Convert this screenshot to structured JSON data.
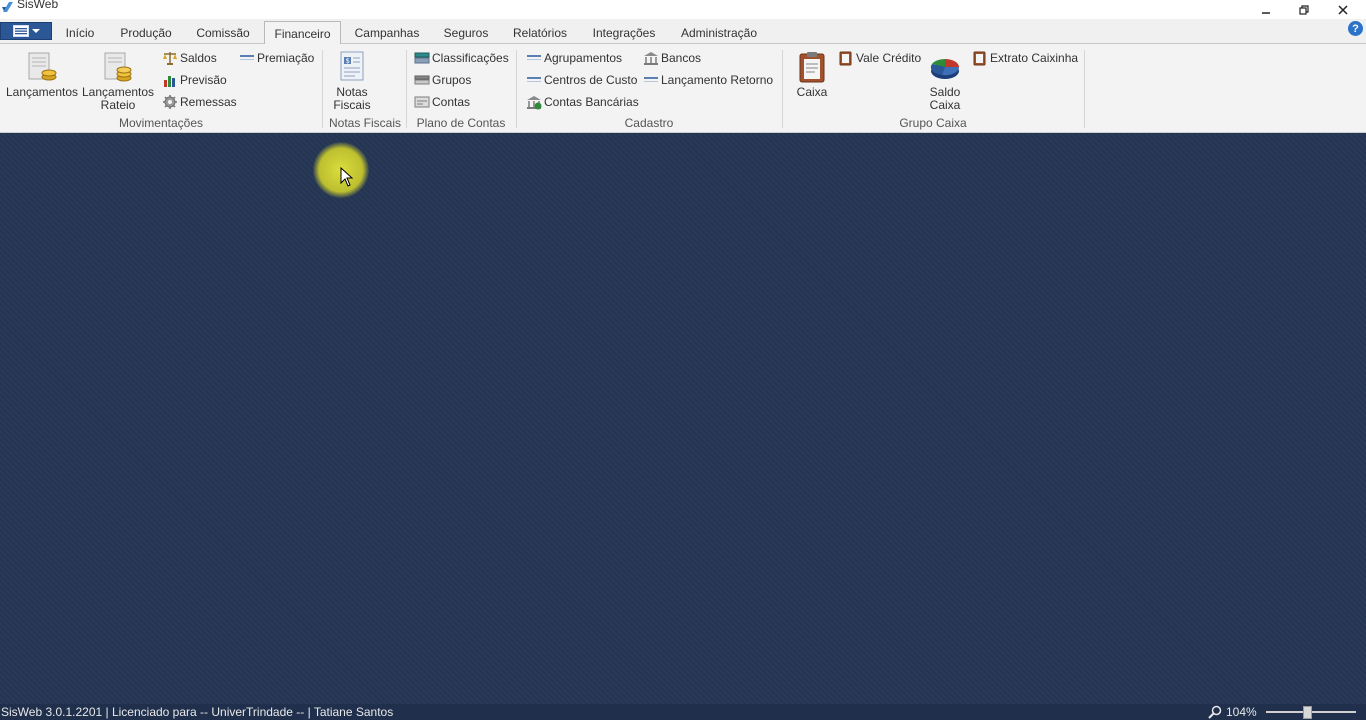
{
  "window": {
    "title": "SisWeb",
    "controls": [
      "minimize-icon",
      "restore-icon",
      "close-icon"
    ]
  },
  "tabs": [
    {
      "label": "Início"
    },
    {
      "label": "Produção"
    },
    {
      "label": "Comissão"
    },
    {
      "label": "Financeiro",
      "active": true
    },
    {
      "label": "Campanhas"
    },
    {
      "label": "Seguros"
    },
    {
      "label": "Relatórios"
    },
    {
      "label": "Integrações"
    },
    {
      "label": "Administração"
    }
  ],
  "help": {
    "label": "?"
  },
  "ribbon": {
    "movimentacoes": {
      "label": "Movimentações",
      "lancamentos": "Lançamentos",
      "lancamentos_rateio": "Lançamentos Rateio",
      "saldos": "Saldos",
      "previsao": "Previsão",
      "remessas": "Remessas",
      "premiacao": "Premiação"
    },
    "notas_fiscais": {
      "label": "Notas Fiscais",
      "notas_fiscais_btn": "Notas Fiscais"
    },
    "plano_de_contas": {
      "label": "Plano de Contas",
      "classificacoes": "Classificações",
      "grupos": "Grupos",
      "contas": "Contas"
    },
    "cadastro": {
      "label": "Cadastro",
      "agrupamentos": "Agrupamentos",
      "centros_de_custo": "Centros de Custo",
      "contas_bancarias": "Contas Bancárias",
      "bancos": "Bancos",
      "lancamento_retorno": "Lançamento Retorno"
    },
    "grupo_caixa": {
      "label": "Grupo Caixa",
      "caixa": "Caixa",
      "vale_credito": "Vale Crédito",
      "saldo_caixa": "Saldo Caixa",
      "extrato_caixinha": "Extrato Caixinha"
    }
  },
  "statusbar": {
    "text": "SisWeb 3.0.1.2201 | Licenciado para -- UniverTrindade -- | Tatiane Santos",
    "zoom": "104%"
  },
  "colors": {
    "workspace": "#243553",
    "statusbar": "#1f2f4c",
    "app_menu": "#2b5797",
    "ribbon": "#f3f3f3",
    "cursor_highlight": "#e0e03c"
  }
}
